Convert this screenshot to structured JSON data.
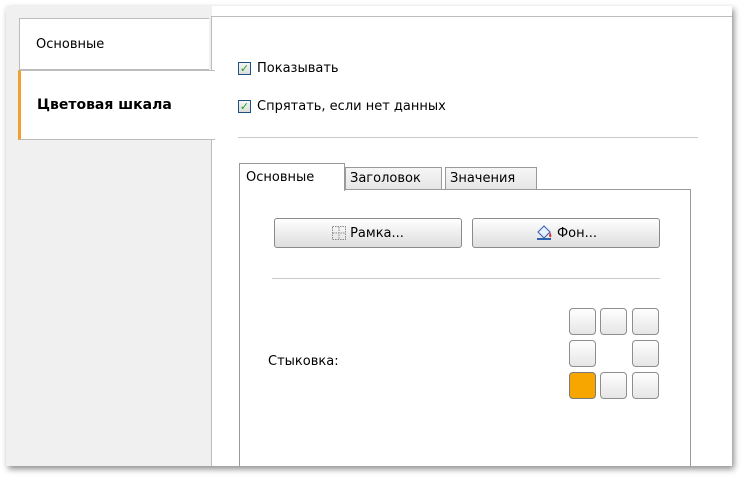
{
  "left_tabs": [
    {
      "label": "Основные",
      "active": false
    },
    {
      "label": "Цветовая шкала",
      "active": true
    }
  ],
  "checkboxes": {
    "show": {
      "label": "Показывать",
      "checked": true
    },
    "hide_no_data": {
      "label": "Спрятать, если нет данных",
      "checked": true
    }
  },
  "inner_tabs": [
    {
      "label": "Основные",
      "active": true
    },
    {
      "label": "Заголовок",
      "active": false
    },
    {
      "label": "Значения",
      "active": false
    }
  ],
  "buttons": {
    "frame": {
      "label": "Рамка...",
      "icon": "frame-icon"
    },
    "background": {
      "label": "Фон...",
      "icon": "paint-bucket-icon"
    }
  },
  "docking": {
    "label": "Стыковка:",
    "selected": "bottom-left"
  },
  "colors": {
    "accent": "#f0a030",
    "dock_selected": "#f7a600",
    "check": "#21a121"
  }
}
